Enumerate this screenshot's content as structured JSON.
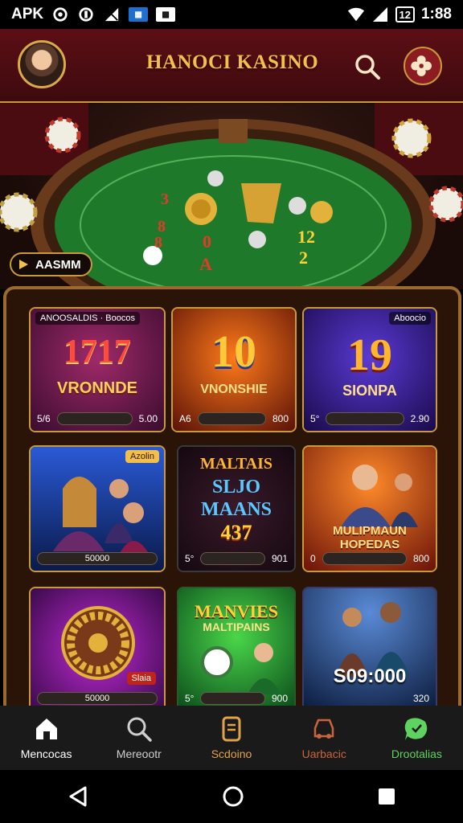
{
  "status_bar": {
    "left_text": "APK",
    "right_battery": "12",
    "time": "1:88"
  },
  "header": {
    "brand": "HANOCI KASINO",
    "icons": [
      "avatar",
      "search-icon",
      "menu-icon"
    ]
  },
  "hero": {
    "label": "AASMM"
  },
  "games": [
    {
      "tag": "ANOOSALDIS · Boocos",
      "big": "1717",
      "title": "VRONNDE",
      "foot_left": "5/6",
      "foot_right": "5.00",
      "bar_text": ""
    },
    {
      "tag": "",
      "big": "10",
      "title": "VNONSHIE",
      "foot_left": "A6",
      "foot_right": "800",
      "bar_text": ""
    },
    {
      "tag": "Aboocio",
      "big": "19",
      "title": "SIONPA",
      "foot_left": "5°",
      "foot_right": "2.90",
      "bar_text": ""
    },
    {
      "tag": "Azolin",
      "big": "",
      "title": "",
      "foot_left": "",
      "foot_right": "",
      "bar_text": "50000"
    },
    {
      "tag": "",
      "big": "MALTAIS",
      "title": "SLJO MAANS",
      "extra": "437",
      "foot_left": "5°",
      "foot_right": "901",
      "bar_text": ""
    },
    {
      "tag": "",
      "big": "",
      "title": "MULIPMAUN HOPEDAS",
      "foot_left": "0",
      "foot_right": "800",
      "bar_text": ""
    },
    {
      "tag": "",
      "big": "",
      "title": "",
      "badge": "Slaia",
      "foot_left": "",
      "foot_right": "",
      "bar_text": "50000"
    },
    {
      "tag": "",
      "big": "MANVIES",
      "title": "MALTIPAINS",
      "foot_left": "5°",
      "foot_right": "900",
      "bar_text": ""
    },
    {
      "tag": "",
      "big": "",
      "title": "S09:000",
      "foot_left": "",
      "foot_right": "320",
      "bar_text": ""
    }
  ],
  "nav": [
    {
      "label": "Mencocas",
      "color": "#ffffff"
    },
    {
      "label": "Mereootr",
      "color": "#cfcfcf"
    },
    {
      "label": "Scdoino",
      "color": "#e0a34a"
    },
    {
      "label": "Uarbacic",
      "color": "#c9653c"
    },
    {
      "label": "Drootalias",
      "color": "#5fd35f"
    }
  ]
}
